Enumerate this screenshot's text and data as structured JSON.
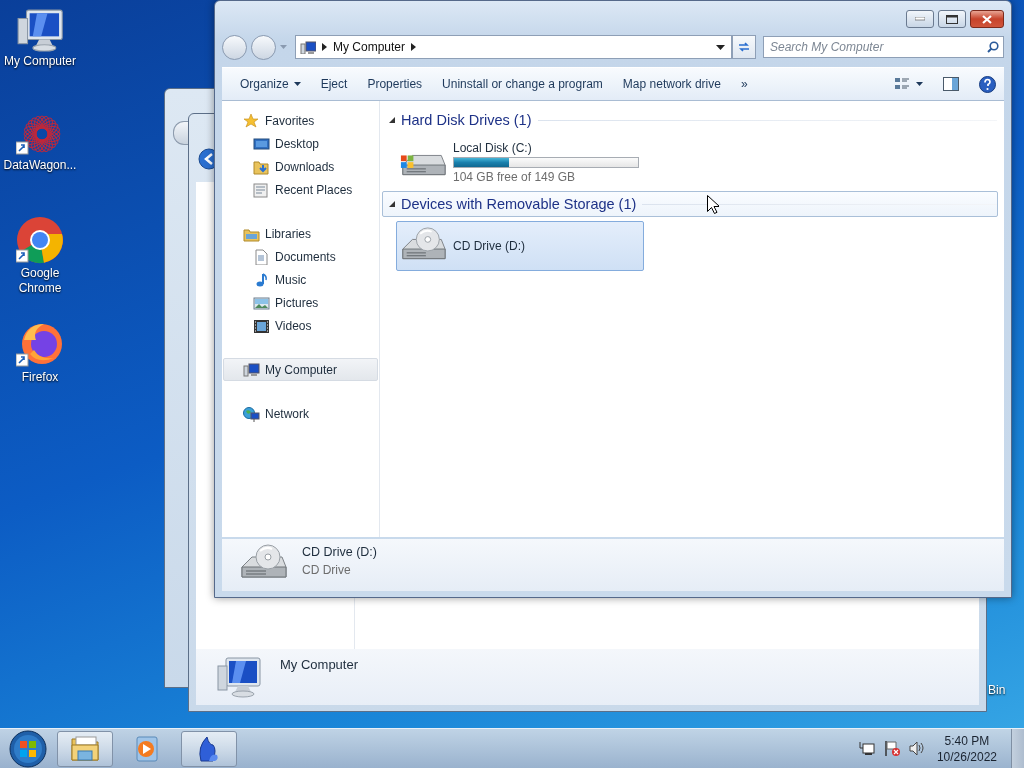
{
  "desktop_icons": [
    {
      "kind": "computer",
      "label": "My Computer"
    },
    {
      "kind": "datawagon",
      "label": "DataWagon..."
    },
    {
      "kind": "chrome",
      "label": "Google Chrome"
    },
    {
      "kind": "firefox",
      "label": "Firefox"
    }
  ],
  "recycle_bin": {
    "label": "Bin"
  },
  "back_window": {
    "details_title": "My Computer"
  },
  "window": {
    "address": [
      "My Computer"
    ],
    "search": {
      "placeholder": "Search My Computer"
    },
    "toolbar": [
      {
        "label": "Organize",
        "dropdown": true
      },
      {
        "label": "Eject",
        "dropdown": false
      },
      {
        "label": "Properties",
        "dropdown": false
      },
      {
        "label": "Uninstall or change a program",
        "dropdown": false
      },
      {
        "label": "Map network drive",
        "dropdown": false
      },
      {
        "label": "»",
        "dropdown": false
      }
    ],
    "sidebar": [
      {
        "kind": "favorites",
        "label": "Favorites",
        "selected": false,
        "children": [
          {
            "kind": "desktop",
            "label": "Desktop",
            "selected": false
          },
          {
            "kind": "downloads",
            "label": "Downloads",
            "selected": false
          },
          {
            "kind": "recent",
            "label": "Recent Places",
            "selected": false
          }
        ]
      },
      {
        "kind": "libraries",
        "label": "Libraries",
        "selected": false,
        "children": [
          {
            "kind": "documents",
            "label": "Documents",
            "selected": false
          },
          {
            "kind": "music",
            "label": "Music",
            "selected": false
          },
          {
            "kind": "pictures",
            "label": "Pictures",
            "selected": false
          },
          {
            "kind": "videos",
            "label": "Videos",
            "selected": false
          }
        ]
      },
      {
        "kind": "computer",
        "label": "My Computer",
        "selected": true
      },
      {
        "kind": "network",
        "label": "Network",
        "selected": false
      }
    ],
    "groups": [
      {
        "title": "Hard Disk Drives (1)",
        "expanded": true,
        "focused": false,
        "items": [
          {
            "kind": "disk",
            "name": "Local Disk (C:)",
            "level": 0.3,
            "info": "104 GB free of 149 GB",
            "selected": false
          }
        ]
      },
      {
        "title": "Devices with Removable Storage (1)",
        "expanded": true,
        "focused": true,
        "items": [
          {
            "kind": "cd",
            "name": "CD Drive (D:)",
            "selected": true
          }
        ]
      }
    ],
    "details": {
      "kind": "cd",
      "name": "CD Drive (D:)",
      "type": "CD Drive"
    }
  },
  "taskbar": {
    "buttons": [
      {
        "kind": "explorer",
        "running": true
      },
      {
        "kind": "media",
        "running": false
      },
      {
        "kind": "app",
        "running": true
      }
    ],
    "tray": [
      {
        "kind": "network"
      },
      {
        "kind": "flag"
      },
      {
        "kind": "volume"
      }
    ],
    "time": "5:40 PM",
    "date": "10/26/2022"
  }
}
